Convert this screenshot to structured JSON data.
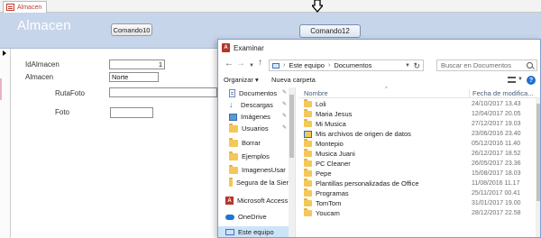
{
  "access": {
    "tab_label": "Almacen",
    "form_title": "Almacen",
    "button_cmd10": "Comando10",
    "button_cmd12": "Comando12",
    "fields": {
      "idalmacen_label": "IdAlmacen",
      "idalmacen_value": "1",
      "almacen_label": "Almacen",
      "almacen_value": "Norte",
      "rutafoto_label": "RutaFoto",
      "rutafoto_value": "",
      "foto_label": "Foto"
    }
  },
  "dialog": {
    "title": "Examinar",
    "path": [
      "Este equipo",
      "Documentos"
    ],
    "search_placeholder": "Buscar en Documentos",
    "toolbar": {
      "organizar": "Organizar ▾",
      "nueva_carpeta": "Nueva carpeta"
    },
    "nav": [
      {
        "label": "Documentos",
        "icon": "document-icon",
        "pinned": true
      },
      {
        "label": "Descargas",
        "icon": "download-icon",
        "pinned": true
      },
      {
        "label": "Imágenes",
        "icon": "image-icon",
        "pinned": true
      },
      {
        "label": "Usuarios",
        "icon": "folder-icon",
        "pinned": true
      },
      {
        "label": "Borrar",
        "icon": "folder-icon",
        "pinned": false
      },
      {
        "label": "Ejemplos",
        "icon": "folder-icon",
        "pinned": false
      },
      {
        "label": "ImagenesUsar",
        "icon": "folder-icon",
        "pinned": false
      },
      {
        "label": "Segura de la Sier",
        "icon": "folder-icon",
        "pinned": false
      },
      {
        "label": "Microsoft Access",
        "icon": "access-icon",
        "pinned": false
      },
      {
        "label": "OneDrive",
        "icon": "cloud-icon",
        "pinned": false
      },
      {
        "label": "Este equipo",
        "icon": "computer-icon",
        "pinned": false
      }
    ],
    "columns": {
      "name": "Nombre",
      "date": "Fecha de modifica..."
    },
    "files": [
      {
        "name": "Loli",
        "date": "24/10/2017 13.43"
      },
      {
        "name": "Maria Jesus",
        "date": "12/04/2017 20.05"
      },
      {
        "name": "Mi Musica",
        "date": "27/12/2017 19.03"
      },
      {
        "name": "Mis archivos de origen de datos",
        "date": "23/06/2016 23.40",
        "special": true
      },
      {
        "name": "Montepio",
        "date": "05/12/2016 11.40"
      },
      {
        "name": "Musica Juani",
        "date": "26/12/2017 18.52"
      },
      {
        "name": "PC Cleaner",
        "date": "26/05/2017 23.36"
      },
      {
        "name": "Pepe",
        "date": "15/08/2017 18.03"
      },
      {
        "name": "Plantillas personalizadas de Office",
        "date": "11/08/2016 11.17"
      },
      {
        "name": "Programas",
        "date": "25/11/2017 00.41"
      },
      {
        "name": "TomTom",
        "date": "31/01/2017 19.00"
      },
      {
        "name": "Youcam",
        "date": "28/12/2017 22.58"
      }
    ]
  }
}
